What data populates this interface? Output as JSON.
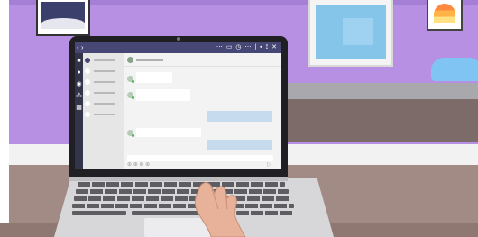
{
  "scene": {
    "colors": {
      "wall": "#b78fe3",
      "desk": "#a38b85",
      "teams_purple": "#464775",
      "outgoing_bubble": "#c7dbef"
    }
  },
  "app": {
    "titlebar": {
      "nav_glyph": "‹ ›",
      "tool_glyphs": "⋯ ▭ ◷ ⋯ | ▪ ⟟ ✕"
    },
    "rail_icons": [
      "activity-icon",
      "bell-icon",
      "chat-icon",
      "teams-icon",
      "calendar-icon"
    ],
    "chat_list": {
      "items": [
        {
          "active": true
        },
        {
          "active": false
        },
        {
          "active": false
        },
        {
          "active": false
        },
        {
          "active": false
        },
        {
          "active": false
        }
      ]
    },
    "conversation": {
      "messages": [
        {
          "direction": "incoming"
        },
        {
          "direction": "incoming"
        },
        {
          "direction": "outgoing"
        },
        {
          "direction": "incoming"
        },
        {
          "direction": "outgoing"
        }
      ]
    },
    "compose_bar": {
      "format_glyphs": "⊕ ⊕ ⊕ ⊕",
      "send_glyph": "▷"
    }
  }
}
